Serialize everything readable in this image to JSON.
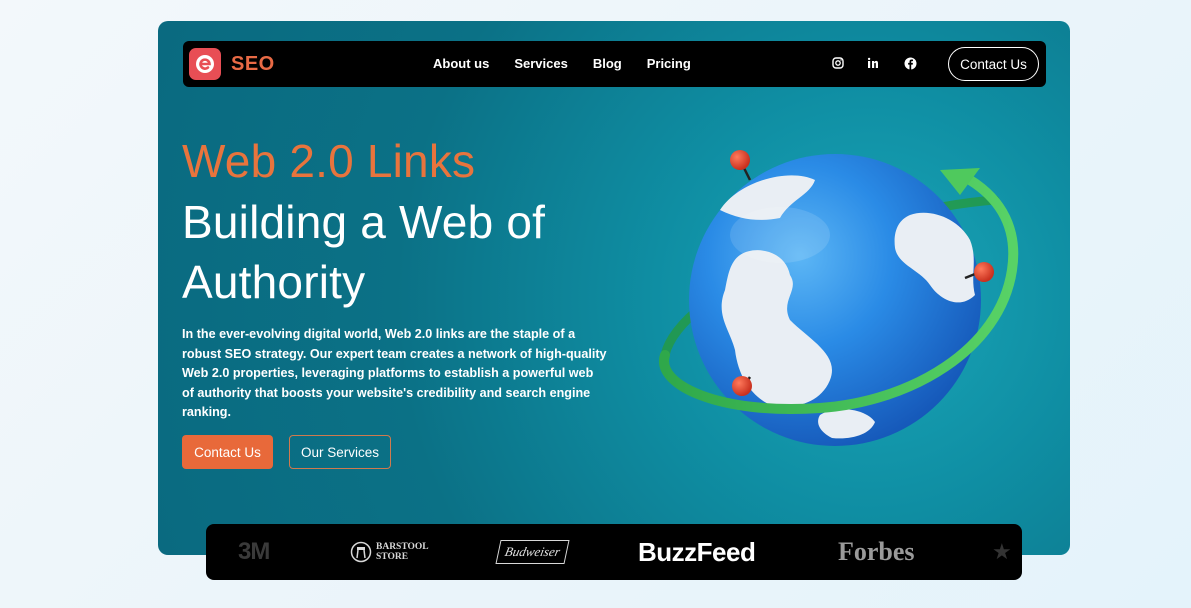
{
  "brand": {
    "name": "SEO",
    "logo_letter": "e",
    "accent_color": "#e84e55"
  },
  "nav": {
    "links": [
      "About us",
      "Services",
      "Blog",
      "Pricing"
    ],
    "social": [
      "instagram-icon",
      "linkedin-icon",
      "facebook-icon"
    ],
    "contact_label": "Contact Us"
  },
  "hero": {
    "accent_heading": "Web 2.0 Links",
    "heading_line1": "Building a Web of",
    "heading_line2": "Authority",
    "description": "In the ever-evolving digital world, Web 2.0 links are the staple of a robust SEO strategy. Our expert team creates a network of high-quality Web 2.0 properties, leveraging platforms to establish a powerful web of authority that boosts your website's credibility and search engine ranking.",
    "primary_button": "Contact Us",
    "secondary_button": "Our Services",
    "illustration": "globe-with-pins-and-orbit-arrow"
  },
  "brands": {
    "logos": [
      "3M",
      "BARSTOOL",
      "STORE",
      "Budweiser",
      "BuzzFeed",
      "Forbes"
    ]
  },
  "colors": {
    "hero_bg": "#0b7186",
    "accent": "#e8743d",
    "navbar_bg": "#000000"
  }
}
